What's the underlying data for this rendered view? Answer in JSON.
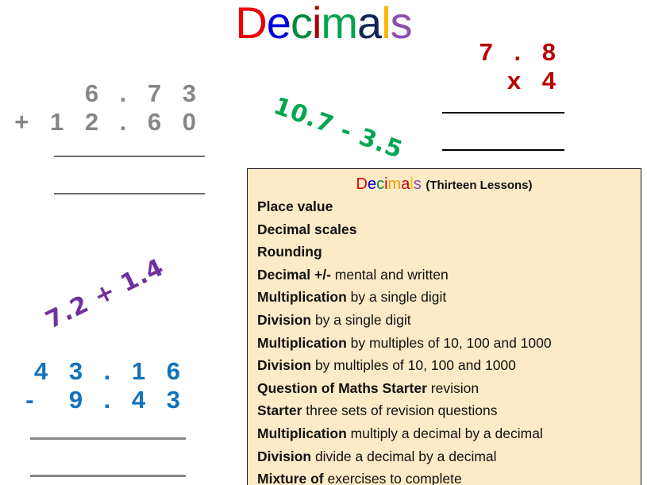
{
  "title": {
    "text": "Decimals",
    "letters": [
      {
        "ch": "D",
        "color": "#ee0000"
      },
      {
        "ch": "e",
        "color": "#0000dd"
      },
      {
        "ch": "c",
        "color": "#008a3c"
      },
      {
        "ch": "i",
        "color": "#aa0000"
      },
      {
        "ch": "m",
        "color": "#00a551"
      },
      {
        "ch": "a",
        "color": "#10265a"
      },
      {
        "ch": "l",
        "color": "#ffb400"
      },
      {
        "ch": "s",
        "color": "#8a4fb0"
      }
    ]
  },
  "addition": {
    "name": "column addition",
    "color": "#868686",
    "top_row": "6 . 7 3",
    "bottom_row": "+ 1 2 . 6 0",
    "answer": ""
  },
  "multiplication": {
    "name": "column multiplication",
    "color": "#bb0000",
    "top_row": "7 . 8",
    "bottom_row": "x 4",
    "answer": ""
  },
  "subtraction": {
    "name": "column subtraction",
    "color": "#1272bb",
    "top_row": "4 3 . 1 6",
    "bottom_row": "-  9 . 4 3",
    "answer": ""
  },
  "notes": [
    {
      "text": "10.7 - 3.5",
      "color": "#00a651"
    },
    {
      "text": "7.2 + 1.4",
      "color": "#7030a0"
    }
  ],
  "panel": {
    "background": "#fdeac7",
    "heading_letters": [
      {
        "ch": "D",
        "color": "#ee0000"
      },
      {
        "ch": "e",
        "color": "#0000dd"
      },
      {
        "ch": "c",
        "color": "#008a3c"
      },
      {
        "ch": "i",
        "color": "#cc0000"
      },
      {
        "ch": "m",
        "color": "#e8a000"
      },
      {
        "ch": "a",
        "color": "#cc0000"
      },
      {
        "ch": "l",
        "color": "#ffc000"
      },
      {
        "ch": "s",
        "color": "#8a4fb0"
      }
    ],
    "heading_word": "Decimals",
    "subtitle": "(Thirteen Lessons)",
    "lessons": [
      {
        "bold": "Place value",
        "rest": ""
      },
      {
        "bold": "Decimal scales",
        "rest": ""
      },
      {
        "bold": "Rounding",
        "rest": ""
      },
      {
        "bold": "Decimal +/-",
        "rest": " mental and written"
      },
      {
        "bold": "Multiplication",
        "rest": "  by a single digit"
      },
      {
        "bold": "Division",
        "rest": "  by a single digit"
      },
      {
        "bold": "Multiplication",
        "rest": "  by multiples of 10, 100 and 1000"
      },
      {
        "bold": "Division",
        "rest": " by multiples of 10, 100 and 1000"
      },
      {
        "bold": "Question of Maths Starter",
        "rest": "  revision"
      },
      {
        "bold": "Starter",
        "rest": "  three sets of revision questions"
      },
      {
        "bold": "Multiplication",
        "rest": "  multiply a decimal by a decimal"
      },
      {
        "bold": "Division",
        "rest": "  divide a decimal by a decimal"
      },
      {
        "bold": "Mixture of",
        "rest": " exercises to complete"
      }
    ]
  }
}
